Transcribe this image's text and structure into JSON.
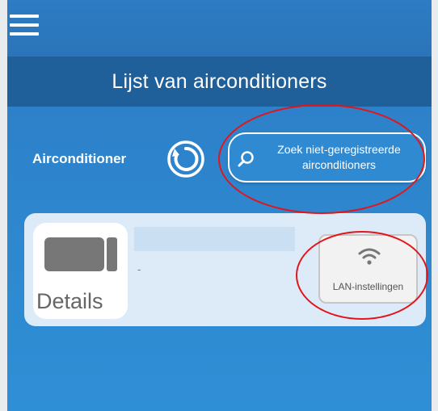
{
  "header": {
    "title": "Lijst van airconditioners",
    "menu_icon": "hamburger-menu-icon"
  },
  "toolbar": {
    "section_label": "Airconditioner",
    "refresh_icon": "refresh-icon",
    "search_button_label": "Zoek niet-geregistreerde airconditioners",
    "search_icon": "magnifier-icon"
  },
  "unit_card": {
    "details_label": "Details",
    "unit_icon": "air-conditioner-icon",
    "name": "",
    "status": "-",
    "lan_label": "LAN-instellingen",
    "wifi_icon": "wifi-icon"
  },
  "colors": {
    "header_bg": "#2c74b9",
    "title_bg": "#1f5f9a",
    "body_bg": "#2f8fd6",
    "card_bg": "#dcebf7",
    "annotation": "#e3151a"
  }
}
